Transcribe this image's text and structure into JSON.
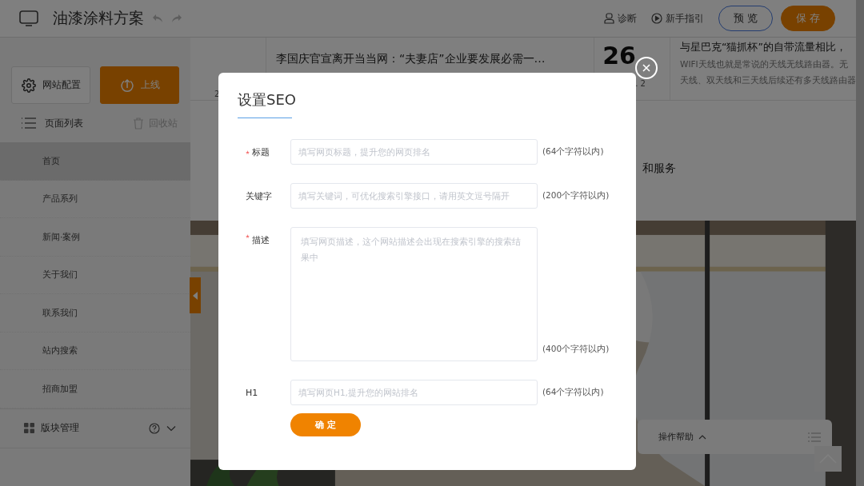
{
  "header": {
    "title": "油漆涂料方案",
    "actions": [
      {
        "label": "诊断",
        "kind": "diagnose"
      },
      {
        "label": "新手指引",
        "kind": "guide"
      }
    ],
    "buttons": [
      {
        "label": "预 览",
        "kind": "outline"
      },
      {
        "label": "保 存",
        "kind": "primary"
      }
    ]
  },
  "sidebar": {
    "buttons": [
      {
        "label": "网站配置",
        "kind": "plain"
      },
      {
        "label": "上线",
        "kind": "primary"
      }
    ],
    "page_list": {
      "title": "页面列表",
      "recycle": "回收站"
    },
    "pages": [
      {
        "label": "首页",
        "selected": true
      },
      {
        "label": "产品系列",
        "selected": false
      },
      {
        "label": "新闻·案例",
        "selected": false
      },
      {
        "label": "关于我们",
        "selected": false
      },
      {
        "label": "联系我们",
        "selected": false
      },
      {
        "label": "站内搜索",
        "selected": false
      },
      {
        "label": "招商加盟",
        "selected": false
      }
    ],
    "block_manage": {
      "label": "版块管理"
    }
  },
  "content": {
    "news": [
      {
        "date": "2",
        "title": "李国庆官宣离开当当网：“夫妻店”企业要发展必需一…"
      },
      {
        "day": "26",
        "date": ". 2",
        "title": "与星巴克“猫抓杯”的自带流量相比，",
        "summary": [
          "WIFI天线也就是常说的天线无线路由器。无",
          "天线、双天线和三天线后续还有多天线路由器"
        ]
      }
    ],
    "fragment": "和服务",
    "help": {
      "label": "操作帮助"
    }
  },
  "dialog": {
    "title": "设置SEO",
    "fields": [
      {
        "label": "标题",
        "required": true,
        "kind": "input",
        "placeholder": "填写网页标题，提升您的网页排名",
        "limit": "(64个字符以内)"
      },
      {
        "label": "关键字",
        "required": false,
        "kind": "input",
        "placeholder": "填写关键词，可优化搜索引擎接口，请用英文逗号隔开",
        "limit": "(200个字符以内)"
      },
      {
        "label": "描述",
        "required": true,
        "kind": "textarea",
        "placeholder": "填写网页描述，这个网站描述会出现在搜索引擎的搜索结果中",
        "limit": "(400个字符以内)"
      },
      {
        "label": "H1",
        "required": false,
        "kind": "input",
        "placeholder": "填写网页H1,提升您的网站排名",
        "limit": "(64个字符以内)"
      }
    ],
    "confirm": "确 定"
  }
}
